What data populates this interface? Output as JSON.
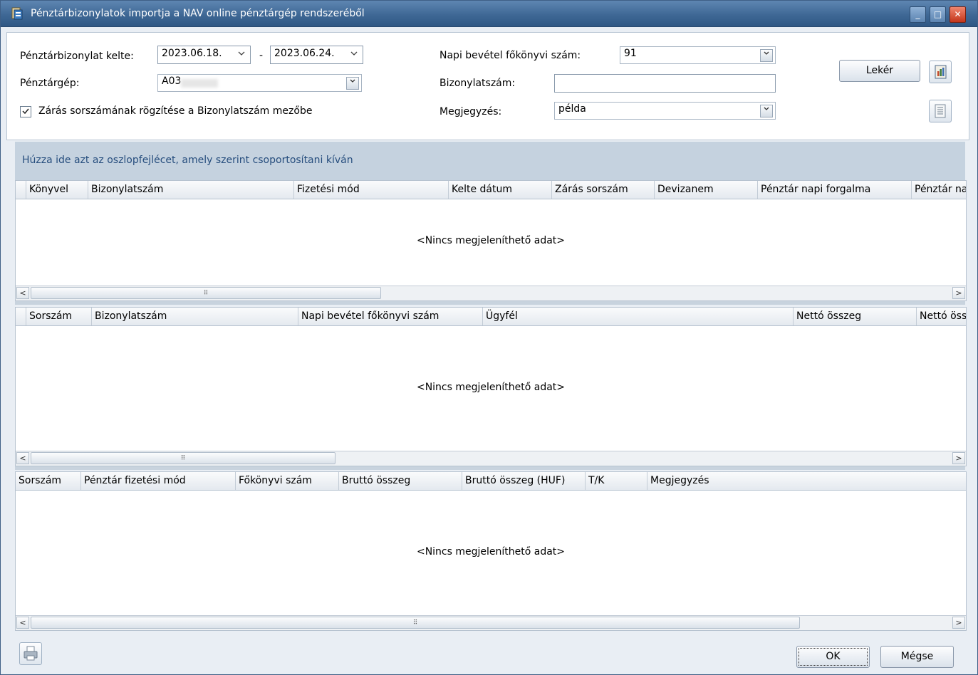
{
  "window": {
    "title": "Pénztárbizonylatok importja a NAV online pénztárgép rendszeréből",
    "minimize_glyph": "_",
    "maximize_glyph": "□",
    "close_glyph": "✕"
  },
  "form": {
    "date_label": "Pénztárbizonylat kelte:",
    "date_from": "2023.06.18.",
    "date_separator": "-",
    "date_to": "2023.06.24.",
    "register_label": "Pénztárgép:",
    "register_value": "A03",
    "closing_checkbox_label": "Zárás sorszámának rögzítése a Bizonylatszám mezőbe",
    "closing_checkbox_checked": true,
    "revenue_account_label": "Napi bevétel főkönyvi szám:",
    "revenue_account_value": "91",
    "document_number_label": "Bizonylatszám:",
    "document_number_value": "",
    "note_label": "Megjegyzés:",
    "note_value": "példa",
    "fetch_button": "Lekér"
  },
  "group_panel": {
    "hint": "Húzza ide azt az oszlopfejlécet, amely szerint csoportosítani kíván"
  },
  "grid1": {
    "columns": [
      "Könyvel",
      "Bizonylatszám",
      "Fizetési mód",
      "Kelte dátum",
      "Zárás sorszám",
      "Devizanem",
      "Pénztár napi forgalma",
      "Pénztár na"
    ],
    "empty_text": "<Nincs megjeleníthető adat>"
  },
  "grid2": {
    "columns": [
      "Sorszám",
      "Bizonylatszám",
      "Napi bevétel főkönyvi szám",
      "Ügyfél",
      "Nettó összeg",
      "Nettó öss"
    ],
    "empty_text": "<Nincs megjeleníthető adat>"
  },
  "grid3": {
    "columns": [
      "Sorszám",
      "Pénztár fizetési mód",
      "Főkönyvi szám",
      "Bruttó összeg",
      "Bruttó összeg (HUF)",
      "T/K",
      "Megjegyzés"
    ],
    "empty_text": "<Nincs megjeleníthető adat>"
  },
  "footer": {
    "ok_button": "OK",
    "cancel_button": "Mégse"
  },
  "scrollbar": {
    "left_arrow": "<",
    "right_arrow": ">",
    "grip": "⠿"
  },
  "icons": {
    "app": "app-icon",
    "report": "report-icon",
    "list": "list-icon",
    "print": "print-icon"
  },
  "colors": {
    "titlebar": "#3f6895",
    "group_hint_text": "#274e7e",
    "close_button": "#c3351a"
  }
}
